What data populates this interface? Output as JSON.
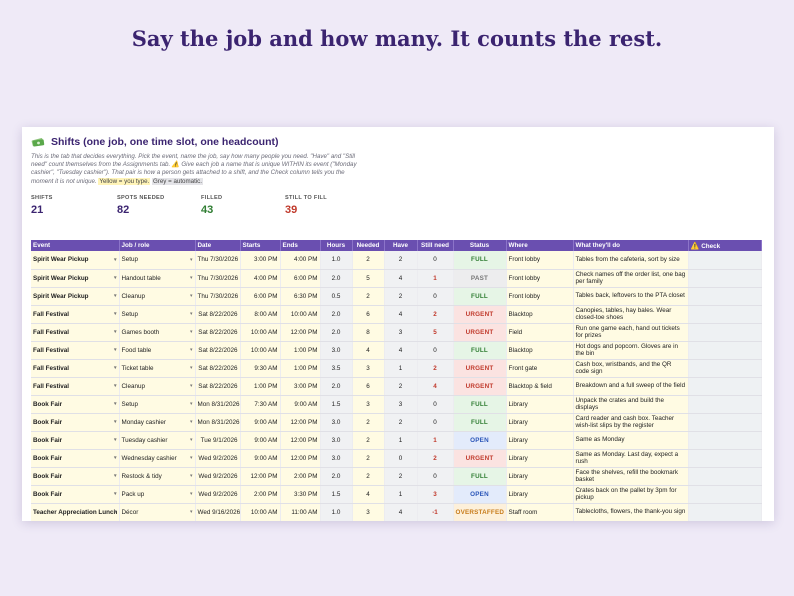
{
  "headline": "Say the job and how many. It counts the rest.",
  "sheet": {
    "title_icon": "money-icon",
    "title": "Shifts  (one job, one time slot, one headcount)",
    "description_parts": {
      "text1": "This is the tab that decides everything. Pick the event, name the job, say how many people you need. \"Have\" and \"Still need\" count themselves from the Assignments tab.  ",
      "warn_icon": "⚠️",
      "text2": " Give each job a name that is unique WITHIN its event (\"Monday cashier\", \"Tuesday cashier\"). That pair is how a person gets attached to a shift, and the Check column tells you the moment it is not unique.  ",
      "yellow_label": "Yellow = you type.",
      "grey_label": "Grey = automatic."
    },
    "stats": [
      {
        "label": "SHIFTS",
        "value": "21",
        "color": "#3b2470"
      },
      {
        "label": "SPOTS NEEDED",
        "value": "82",
        "color": "#3b2470"
      },
      {
        "label": "FILLED",
        "value": "43",
        "color": "#2f7d32"
      },
      {
        "label": "STILL TO FILL",
        "value": "39",
        "color": "#c0392b"
      }
    ],
    "columns": [
      "Event",
      "Job / role",
      "Date",
      "Starts",
      "Ends",
      "Hours",
      "Needed",
      "Have",
      "Still need",
      "Status",
      "Where",
      "What they'll do",
      "Check"
    ],
    "check_icon": "⚠️",
    "rows": [
      {
        "event": "Spirit Wear Pickup",
        "job": "Setup",
        "date": "Thu 7/30/2026",
        "starts": "3:00 PM",
        "ends": "4:00 PM",
        "hours": "1.0",
        "needed": "2",
        "have": "2",
        "still": "0",
        "status": "FULL",
        "where": "Front lobby",
        "todo": "Tables from the cafeteria, sort by size"
      },
      {
        "event": "Spirit Wear Pickup",
        "job": "Handout table",
        "date": "Thu 7/30/2026",
        "starts": "4:00 PM",
        "ends": "6:00 PM",
        "hours": "2.0",
        "needed": "5",
        "have": "4",
        "still": "1",
        "status": "PAST",
        "where": "Front lobby",
        "todo": "Check names off the order list, one bag per family"
      },
      {
        "event": "Spirit Wear Pickup",
        "job": "Cleanup",
        "date": "Thu 7/30/2026",
        "starts": "6:00 PM",
        "ends": "6:30 PM",
        "hours": "0.5",
        "needed": "2",
        "have": "2",
        "still": "0",
        "status": "FULL",
        "where": "Front lobby",
        "todo": "Tables back, leftovers to the PTA closet"
      },
      {
        "event": "Fall Festival",
        "job": "Setup",
        "date": "Sat 8/22/2026",
        "starts": "8:00 AM",
        "ends": "10:00 AM",
        "hours": "2.0",
        "needed": "6",
        "have": "4",
        "still": "2",
        "status": "URGENT",
        "where": "Blacktop",
        "todo": "Canopies, tables, hay bales. Wear closed-toe shoes"
      },
      {
        "event": "Fall Festival",
        "job": "Games booth",
        "date": "Sat 8/22/2026",
        "starts": "10:00 AM",
        "ends": "12:00 PM",
        "hours": "2.0",
        "needed": "8",
        "have": "3",
        "still": "5",
        "status": "URGENT",
        "where": "Field",
        "todo": "Run one game each, hand out tickets for prizes"
      },
      {
        "event": "Fall Festival",
        "job": "Food table",
        "date": "Sat 8/22/2026",
        "starts": "10:00 AM",
        "ends": "1:00 PM",
        "hours": "3.0",
        "needed": "4",
        "have": "4",
        "still": "0",
        "status": "FULL",
        "where": "Blacktop",
        "todo": "Hot dogs and popcorn. Gloves are in the bin"
      },
      {
        "event": "Fall Festival",
        "job": "Ticket table",
        "date": "Sat 8/22/2026",
        "starts": "9:30 AM",
        "ends": "1:00 PM",
        "hours": "3.5",
        "needed": "3",
        "have": "1",
        "still": "2",
        "status": "URGENT",
        "where": "Front gate",
        "todo": "Cash box, wristbands, and the QR code sign"
      },
      {
        "event": "Fall Festival",
        "job": "Cleanup",
        "date": "Sat 8/22/2026",
        "starts": "1:00 PM",
        "ends": "3:00 PM",
        "hours": "2.0",
        "needed": "6",
        "have": "2",
        "still": "4",
        "status": "URGENT",
        "where": "Blacktop & field",
        "todo": "Breakdown and a full sweep of the field"
      },
      {
        "event": "Book Fair",
        "job": "Setup",
        "date": "Mon 8/31/2026",
        "starts": "7:30 AM",
        "ends": "9:00 AM",
        "hours": "1.5",
        "needed": "3",
        "have": "3",
        "still": "0",
        "status": "FULL",
        "where": "Library",
        "todo": "Unpack the crates and build the displays"
      },
      {
        "event": "Book Fair",
        "job": "Monday cashier",
        "date": "Mon 8/31/2026",
        "starts": "9:00 AM",
        "ends": "12:00 PM",
        "hours": "3.0",
        "needed": "2",
        "have": "2",
        "still": "0",
        "status": "FULL",
        "where": "Library",
        "todo": "Card reader and cash box. Teacher wish-list slips by the register"
      },
      {
        "event": "Book Fair",
        "job": "Tuesday cashier",
        "date": "Tue 9/1/2026",
        "starts": "9:00 AM",
        "ends": "12:00 PM",
        "hours": "3.0",
        "needed": "2",
        "have": "1",
        "still": "1",
        "status": "OPEN",
        "where": "Library",
        "todo": "Same as Monday"
      },
      {
        "event": "Book Fair",
        "job": "Wednesday cashier",
        "date": "Wed 9/2/2026",
        "starts": "9:00 AM",
        "ends": "12:00 PM",
        "hours": "3.0",
        "needed": "2",
        "have": "0",
        "still": "2",
        "status": "URGENT",
        "where": "Library",
        "todo": "Same as Monday. Last day, expect a rush"
      },
      {
        "event": "Book Fair",
        "job": "Restock & tidy",
        "date": "Wed 9/2/2026",
        "starts": "12:00 PM",
        "ends": "2:00 PM",
        "hours": "2.0",
        "needed": "2",
        "have": "2",
        "still": "0",
        "status": "FULL",
        "where": "Library",
        "todo": "Face the shelves, refill the bookmark basket"
      },
      {
        "event": "Book Fair",
        "job": "Pack up",
        "date": "Wed 9/2/2026",
        "starts": "2:00 PM",
        "ends": "3:30 PM",
        "hours": "1.5",
        "needed": "4",
        "have": "1",
        "still": "3",
        "status": "OPEN",
        "where": "Library",
        "todo": "Crates back on the pallet by 3pm for pickup"
      },
      {
        "event": "Teacher Appreciation Lunch",
        "job": "Décor",
        "date": "Wed 9/16/2026",
        "starts": "10:00 AM",
        "ends": "11:00 AM",
        "hours": "1.0",
        "needed": "3",
        "have": "4",
        "still": "-1",
        "status": "OVERSTAFFED",
        "where": "Staff room",
        "todo": "Tablecloths, flowers, the thank-you sign"
      }
    ]
  }
}
